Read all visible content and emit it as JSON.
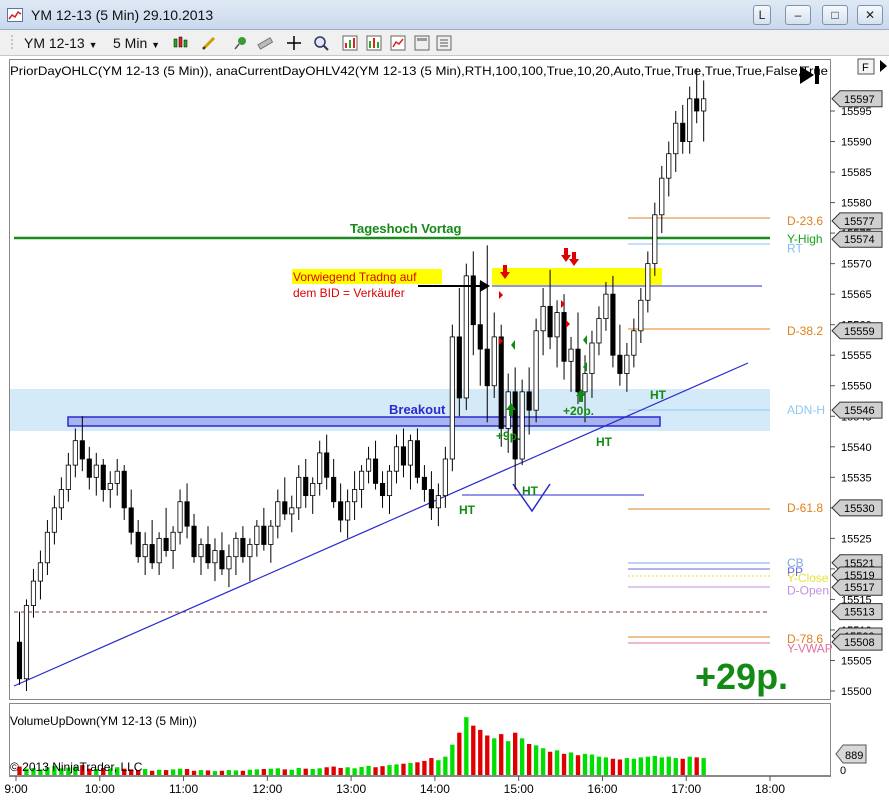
{
  "window": {
    "title": "YM 12-13 (5 Min)  29.10.2013",
    "buttons": {
      "lock": "L",
      "minimize": "–",
      "maximize": "□",
      "close": "✕"
    }
  },
  "toolbar": {
    "instrument": "YM 12-13",
    "interval": "5 Min",
    "icons": [
      "bar-type-icon",
      "draw-tool-icon",
      "pin-icon",
      "ruler-icon",
      "crosshair-icon",
      "zoom-icon",
      "indicators-icon",
      "strategies-icon",
      "properties-icon",
      "template-icon"
    ]
  },
  "indicator_label": "PriorDayOHLC(YM 12-13 (5 Min)),  anaCurrentDayOHLV42(YM 12-13 (5 Min),RTH,100,100,True,10,20,Auto,True,True,True,True,False,True",
  "float_button": "F",
  "last_price_label": "15597",
  "annotations": {
    "tageshoch": "Tageshoch Vortag",
    "bid_line1": "Vorwiegend Tradng auf",
    "bid_line2": "dem BID = Verkäufer",
    "breakout": "Breakout",
    "plus9": "+9p.",
    "plus20": "+20p.",
    "ht1": "HT",
    "ht2": "HT",
    "ht3": "HT",
    "ht4": "HT",
    "big_gain": "+29p."
  },
  "level_labels": [
    {
      "text": "D-23.6",
      "color": "#e08020",
      "value": 15577
    },
    {
      "text": "Y-High",
      "color": "#1aa01a",
      "value": 15574
    },
    {
      "text": "RT",
      "color": "#80c0ff",
      "value": 15572.5
    },
    {
      "text": "D-38.2",
      "color": "#e08020",
      "value": 15559
    },
    {
      "text": "ADN-H",
      "color": "#8ec8f0",
      "value": 15546
    },
    {
      "text": "D-61.8",
      "color": "#e08020",
      "value": 15530
    },
    {
      "text": "CB",
      "color": "#7aa7e6",
      "value": 15521
    },
    {
      "text": "PP",
      "color": "#6a6adf",
      "value": 15519.5
    },
    {
      "text": "Y-Close",
      "color": "#e6e23a",
      "value": 15518.5
    },
    {
      "text": "D-Open",
      "color": "#c090e0",
      "value": 15516.5
    },
    {
      "text": "D-78.6",
      "color": "#e08020",
      "value": 15508.5
    },
    {
      "text": "Y-VWAP",
      "color": "#e070a0",
      "value": 15507
    }
  ],
  "price_tags": [
    "15597",
    "15577",
    "15574",
    "15559",
    "15546",
    "15530",
    "15521",
    "15519",
    "15517",
    "15513",
    "15509",
    "15508"
  ],
  "volume_label": "VolumeUpDown(YM 12-13 (5 Min))",
  "volume_tag": "889",
  "volume_axis_zero": "0",
  "copyright": "© 2013 NinjaTrader, LLC",
  "colors": {
    "up_bar": "#ffffff",
    "down_bar": "#000000",
    "tageshoch_line": "#1a8a1a",
    "trend_line": "#2a2ad0",
    "breakout_zone": "#d4eaf8",
    "resistance_zone": "#ffff00",
    "annotation_green": "#138a13",
    "annotation_red": "#e00000",
    "volume_up": "#00e000",
    "volume_down": "#e00000"
  },
  "chart_data": {
    "type": "candlestick",
    "instrument": "YM 12-13",
    "interval": "5 Min",
    "date": "29.10.2013",
    "ylim": [
      15498,
      15601
    ],
    "y_ticks": [
      15500,
      15505,
      15510,
      15515,
      15520,
      15525,
      15530,
      15535,
      15540,
      15545,
      15550,
      15555,
      15560,
      15565,
      15570,
      15575,
      15580,
      15585,
      15590,
      15595
    ],
    "x_ticks": [
      "9:00",
      "10:00",
      "11:00",
      "12:00",
      "13:00",
      "14:00",
      "15:00",
      "16:00",
      "17:00",
      "18:00"
    ],
    "first_bar_time": "9:00",
    "bar_minutes": 5,
    "levels": [
      {
        "name": "Tageshoch Vortag",
        "value": 15574
      },
      {
        "name": "D-23.6",
        "value": 15577
      },
      {
        "name": "D-38.2",
        "value": 15559
      },
      {
        "name": "ADN-H",
        "value": 15546
      },
      {
        "name": "D-61.8",
        "value": 15530
      },
      {
        "name": "CB",
        "value": 15521
      },
      {
        "name": "PP",
        "value": 15519.5
      },
      {
        "name": "Y-Close",
        "value": 15518.5
      },
      {
        "name": "D-Open",
        "value": 15516.5
      },
      {
        "name": "D-78.6",
        "value": 15508.5
      },
      {
        "name": "Y-VWAP",
        "value": 15507
      },
      {
        "name": "Blue resistance",
        "value": 15566
      }
    ],
    "ohlc": [
      [
        15508,
        15513,
        15501,
        15502
      ],
      [
        15502,
        15515,
        15500,
        15514
      ],
      [
        15514,
        15520,
        15512,
        15518
      ],
      [
        15518,
        15523,
        15515,
        15521
      ],
      [
        15521,
        15528,
        15519,
        15526
      ],
      [
        15526,
        15532,
        15524,
        15530
      ],
      [
        15530,
        15535,
        15528,
        15533
      ],
      [
        15533,
        15539,
        15531,
        15537
      ],
      [
        15537,
        15543,
        15535,
        15541
      ],
      [
        15541,
        15545,
        15536,
        15538
      ],
      [
        15538,
        15540,
        15533,
        15535
      ],
      [
        15535,
        15539,
        15532,
        15537
      ],
      [
        15537,
        15538,
        15531,
        15533
      ],
      [
        15533,
        15536,
        15530,
        15534
      ],
      [
        15534,
        15538,
        15532,
        15536
      ],
      [
        15536,
        15537,
        15528,
        15530
      ],
      [
        15530,
        15533,
        15524,
        15526
      ],
      [
        15526,
        15528,
        15521,
        15522
      ],
      [
        15522,
        15526,
        15519,
        15524
      ],
      [
        15524,
        15528,
        15520,
        15521
      ],
      [
        15521,
        15526,
        15519,
        15525
      ],
      [
        15525,
        15530,
        15522,
        15523
      ],
      [
        15523,
        15527,
        15520,
        15526
      ],
      [
        15526,
        15533,
        15524,
        15531
      ],
      [
        15531,
        15534,
        15525,
        15527
      ],
      [
        15527,
        15529,
        15521,
        15522
      ],
      [
        15522,
        15525,
        15519,
        15524
      ],
      [
        15524,
        15527,
        15520,
        15521
      ],
      [
        15521,
        15525,
        15518,
        15523
      ],
      [
        15523,
        15526,
        15519,
        15520
      ],
      [
        15520,
        15524,
        15517,
        15522
      ],
      [
        15522,
        15526,
        15519,
        15525
      ],
      [
        15525,
        15527,
        15521,
        15522
      ],
      [
        15522,
        15525,
        15518,
        15524
      ],
      [
        15524,
        15528,
        15522,
        15527
      ],
      [
        15527,
        15530,
        15523,
        15524
      ],
      [
        15524,
        15528,
        15521,
        15527
      ],
      [
        15527,
        15533,
        15525,
        15531
      ],
      [
        15531,
        15535,
        15528,
        15529
      ],
      [
        15529,
        15532,
        15526,
        15530
      ],
      [
        15530,
        15537,
        15528,
        15535
      ],
      [
        15535,
        15538,
        15530,
        15532
      ],
      [
        15532,
        15535,
        15529,
        15534
      ],
      [
        15534,
        15541,
        15532,
        15539
      ],
      [
        15539,
        15542,
        15533,
        15535
      ],
      [
        15535,
        15538,
        15530,
        15531
      ],
      [
        15531,
        15534,
        15526,
        15528
      ],
      [
        15528,
        15533,
        15525,
        15531
      ],
      [
        15531,
        15536,
        15528,
        15533
      ],
      [
        15533,
        15537,
        15530,
        15536
      ],
      [
        15536,
        15540,
        15534,
        15538
      ],
      [
        15538,
        15541,
        15533,
        15534
      ],
      [
        15534,
        15536,
        15530,
        15532
      ],
      [
        15532,
        15537,
        15529,
        15536
      ],
      [
        15536,
        15542,
        15534,
        15540
      ],
      [
        15540,
        15543,
        15535,
        15537
      ],
      [
        15537,
        15542,
        15533,
        15541
      ],
      [
        15541,
        15543,
        15534,
        15535
      ],
      [
        15535,
        15537,
        15531,
        15533
      ],
      [
        15533,
        15536,
        15528,
        15530
      ],
      [
        15530,
        15534,
        15527,
        15532
      ],
      [
        15532,
        15540,
        15530,
        15538
      ],
      [
        15538,
        15560,
        15536,
        15558
      ],
      [
        15558,
        15566,
        15545,
        15548
      ],
      [
        15548,
        15570,
        15546,
        15568
      ],
      [
        15568,
        15572,
        15555,
        15560
      ],
      [
        15560,
        15567,
        15550,
        15556
      ],
      [
        15556,
        15573,
        15544,
        15550
      ],
      [
        15550,
        15562,
        15548,
        15558
      ],
      [
        15558,
        15560,
        15540,
        15543
      ],
      [
        15543,
        15552,
        15539,
        15549
      ],
      [
        15549,
        15553,
        15533,
        15538
      ],
      [
        15538,
        15551,
        15537,
        15549
      ],
      [
        15549,
        15553,
        15542,
        15546
      ],
      [
        15546,
        15561,
        15544,
        15559
      ],
      [
        15559,
        15566,
        15555,
        15563
      ],
      [
        15563,
        15569,
        15556,
        15558
      ],
      [
        15558,
        15564,
        15553,
        15562
      ],
      [
        15562,
        15565,
        15551,
        15554
      ],
      [
        15554,
        15558,
        15549,
        15556
      ],
      [
        15556,
        15562,
        15547,
        15549
      ],
      [
        15549,
        15555,
        15544,
        15552
      ],
      [
        15552,
        15559,
        15548,
        15557
      ],
      [
        15557,
        15563,
        15555,
        15561
      ],
      [
        15561,
        15567,
        15559,
        15565
      ],
      [
        15565,
        15568,
        15553,
        15555
      ],
      [
        15555,
        15560,
        15550,
        15552
      ],
      [
        15552,
        15557,
        15549,
        15555
      ],
      [
        15555,
        15561,
        15553,
        15559
      ],
      [
        15559,
        15566,
        15557,
        15564
      ],
      [
        15564,
        15572,
        15562,
        15570
      ],
      [
        15570,
        15580,
        15568,
        15578
      ],
      [
        15578,
        15586,
        15575,
        15584
      ],
      [
        15584,
        15590,
        15581,
        15588
      ],
      [
        15588,
        15595,
        15585,
        15593
      ],
      [
        15593,
        15596,
        15588,
        15590
      ],
      [
        15590,
        15599,
        15588,
        15597
      ],
      [
        15597,
        15602,
        15593,
        15595
      ],
      [
        15595,
        15600,
        15590,
        15597
      ]
    ],
    "volume_panel": {
      "label": "VolumeUpDown(YM 12-13 (5 Min))",
      "last": 889,
      "values": [
        120,
        90,
        100,
        80,
        110,
        130,
        95,
        105,
        120,
        140,
        90,
        85,
        100,
        95,
        110,
        90,
        80,
        70,
        85,
        60,
        75,
        70,
        80,
        90,
        85,
        60,
        70,
        65,
        55,
        60,
        70,
        65,
        60,
        75,
        80,
        85,
        90,
        95,
        80,
        75,
        100,
        90,
        85,
        95,
        110,
        120,
        100,
        110,
        95,
        115,
        130,
        110,
        125,
        140,
        150,
        160,
        170,
        180,
        200,
        240,
        210,
        260,
        430,
        600,
        820,
        700,
        640,
        560,
        520,
        580,
        480,
        600,
        520,
        440,
        420,
        380,
        330,
        350,
        300,
        320,
        280,
        300,
        290,
        260,
        250,
        230,
        220,
        240,
        230,
        250,
        260,
        270,
        250,
        260,
        240,
        230,
        260,
        250,
        240
      ]
    }
  }
}
